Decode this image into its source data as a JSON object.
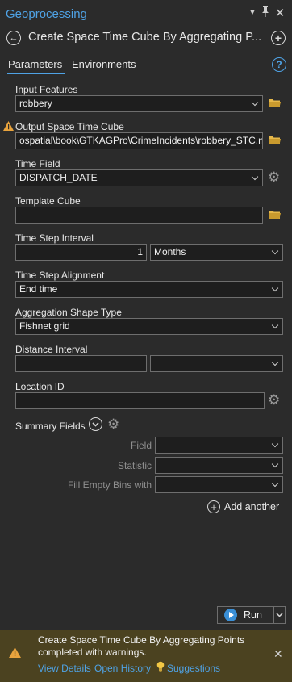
{
  "pane": {
    "title": "Geoprocessing",
    "controls": [
      "dropdown",
      "pin",
      "close"
    ]
  },
  "tool": {
    "title": "Create Space Time Cube By Aggregating P..."
  },
  "tabs": [
    {
      "label": "Parameters",
      "active": true
    },
    {
      "label": "Environments",
      "active": false
    }
  ],
  "params": {
    "input_features": {
      "label": "Input Features",
      "value": "robbery"
    },
    "output_cube": {
      "label": "Output Space Time Cube",
      "value": "ospatial\\book\\GTKAGPro\\CrimeIncidents\\robbery_STC.nc",
      "warning": true
    },
    "time_field": {
      "label": "Time Field",
      "value": "DISPATCH_DATE"
    },
    "template_cube": {
      "label": "Template Cube",
      "value": ""
    },
    "time_step_interval": {
      "label": "Time Step Interval",
      "number": "1",
      "unit": "Months"
    },
    "time_step_alignment": {
      "label": "Time Step Alignment",
      "value": "End time"
    },
    "aggregation_shape": {
      "label": "Aggregation Shape Type",
      "value": "Fishnet grid"
    },
    "distance_interval": {
      "label": "Distance Interval",
      "value": "",
      "unit": ""
    },
    "location_id": {
      "label": "Location ID",
      "value": ""
    }
  },
  "summary": {
    "label": "Summary Fields",
    "field_label": "Field",
    "statistic_label": "Statistic",
    "fill_label": "Fill Empty Bins with",
    "add_another": "Add another"
  },
  "run": {
    "label": "Run"
  },
  "notification": {
    "line1": "Create Space Time Cube By Aggregating Points",
    "line2": "completed with warnings.",
    "view_details": "View Details",
    "open_history": "Open History",
    "suggestions": "Suggestions",
    "status": "warning"
  },
  "colors": {
    "accent": "#4fa3e6",
    "warning": "#e8a33d",
    "folder": "#e6b84a",
    "background": "#2b2b2b",
    "notification_bg": "#4b4220"
  }
}
